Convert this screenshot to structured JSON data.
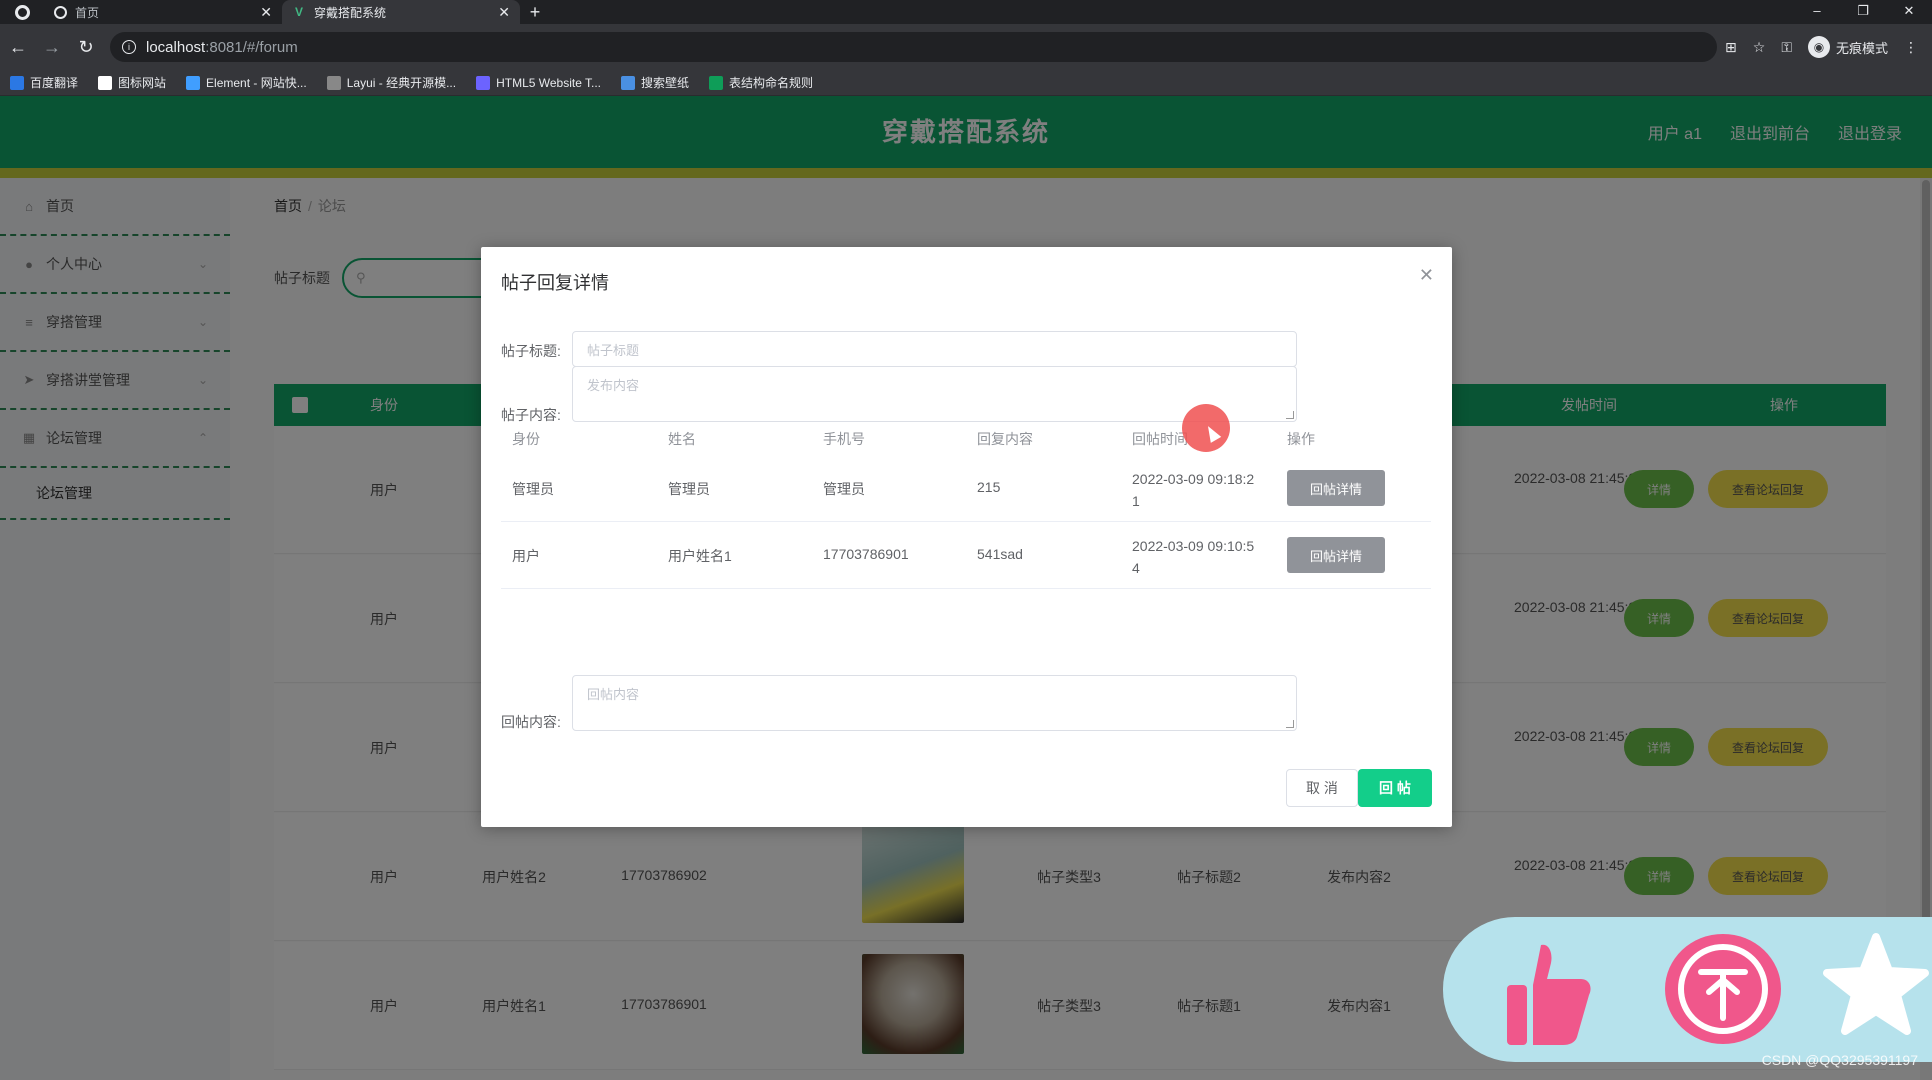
{
  "browser": {
    "tabs": [
      {
        "title": "首页",
        "active": false
      },
      {
        "title": "穿戴搭配系统",
        "active": true
      }
    ],
    "url_host": "localhost",
    "url_rest": ":8081/#/forum",
    "incognito_label": "无痕模式",
    "bookmarks": [
      {
        "label": "百度翻译",
        "color": "#2b78e4"
      },
      {
        "label": "图标网站",
        "color": "#ffffff"
      },
      {
        "label": "Element - 网站快...",
        "color": "#409eff"
      },
      {
        "label": "Layui - 经典开源模...",
        "color": "#888888"
      },
      {
        "label": "HTML5 Website T...",
        "color": "#6c63ff"
      },
      {
        "label": "搜索壁纸",
        "color": "#4a90e2"
      },
      {
        "label": "表结构命名规则",
        "color": "#0f9d58"
      }
    ]
  },
  "header": {
    "title": "穿戴搭配系统",
    "user": "用户 a1",
    "back_to_admin": "退出到前台",
    "logout": "退出登录"
  },
  "sidebar": {
    "items": [
      {
        "label": "首页",
        "icon": "home-icon"
      },
      {
        "label": "个人中心",
        "icon": "user-icon"
      },
      {
        "label": "穿搭管理",
        "icon": "list-icon"
      },
      {
        "label": "穿搭讲堂管理",
        "icon": "send-icon"
      },
      {
        "label": "论坛管理",
        "icon": "grid-icon"
      }
    ],
    "subitem": "论坛管理"
  },
  "main": {
    "breadcrumb_home": "首页",
    "breadcrumb_current": "论坛",
    "search_label": "帖子标题",
    "table_headers": {
      "identity": "身份",
      "post_time": "发帖时间",
      "action": "操作"
    },
    "rows": [
      {
        "identity": "用户",
        "name": "",
        "phone": "",
        "type": "",
        "title": "",
        "content": "",
        "time": "2022-03-08 21:45:24"
      },
      {
        "identity": "用户",
        "name": "",
        "phone": "",
        "type": "",
        "title": "",
        "content": "",
        "time": "2022-03-08 21:45:24"
      },
      {
        "identity": "用户",
        "name": "",
        "phone": "",
        "type": "",
        "title": "",
        "content": "",
        "time": "2022-03-08 21:45:24"
      },
      {
        "identity": "用户",
        "name": "用户姓名2",
        "phone": "17703786902",
        "type": "帖子类型3",
        "title": "帖子标题2",
        "content": "发布内容2",
        "time": "2022-03-08 21:45:24"
      },
      {
        "identity": "用户",
        "name": "用户姓名1",
        "phone": "17703786901",
        "type": "帖子类型3",
        "title": "帖子标题1",
        "content": "发布内容1",
        "time": ""
      }
    ],
    "detail_btn": "详情",
    "reply_btn": "查看论坛回复"
  },
  "modal": {
    "title": "帖子回复详情",
    "post_title_label": "帖子标题:",
    "post_title_placeholder": "帖子标题",
    "post_content_label": "帖子内容:",
    "post_content_placeholder": "发布内容",
    "columns": [
      "身份",
      "姓名",
      "手机号",
      "回复内容",
      "回帖时间",
      "操作"
    ],
    "replies": [
      {
        "identity": "管理员",
        "name": "管理员",
        "phone": "管理员",
        "content": "215",
        "time_line1": "2022-03-09 09:18:2",
        "time_line2": "1",
        "button": "回帖详情"
      },
      {
        "identity": "用户",
        "name": "用户姓名1",
        "phone": "17703786901",
        "content": "541sad",
        "time_line1": "2022-03-09 09:10:5",
        "time_line2": "4",
        "button": "回帖详情"
      }
    ],
    "reply_label": "回帖内容:",
    "reply_placeholder": "回帖内容",
    "cancel": "取 消",
    "submit": "回 帖"
  },
  "overlay_panel": {
    "icons": [
      "thumbs-up-icon",
      "coin-icon",
      "star-icon"
    ]
  },
  "watermark": "CSDN @QQ3295391197",
  "colors": {
    "primary": "#13a968",
    "accent_stripe": "#c9d13a",
    "submit": "#13ce8a",
    "grey_btn": "#909399"
  }
}
